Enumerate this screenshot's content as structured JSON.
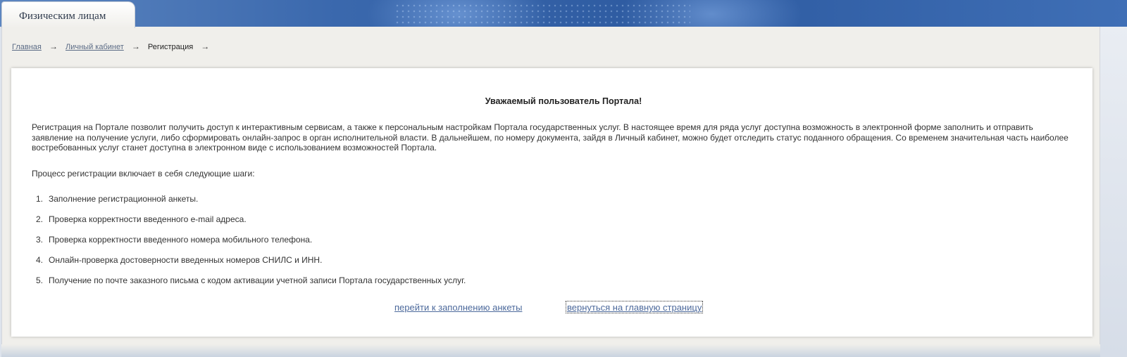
{
  "tabs": {
    "active": "Физическим лицам"
  },
  "breadcrumb": {
    "home": "Главная",
    "cabinet": "Личный кабинет",
    "current": "Регистрация",
    "separator": "→",
    "end_marker": "→"
  },
  "main": {
    "heading": "Уважаемый пользователь Портала!",
    "intro": "Регистрация на Портале позволит получить доступ к интерактивным сервисам, а также к персональным настройкам Портала государственных услуг. В настоящее время для ряда услуг доступна возможность в электронной форме заполнить и отправить заявление на получение услуги, либо сформировать онлайн-запрос в орган исполнительной власти. В дальнейшем, по номеру документа, зайдя в Личный кабинет, можно будет отследить статус поданного обращения. Со временем значительная часть наиболее востребованных услуг станет доступна в электронном виде с использованием возможностей Портала.",
    "steps_intro": "Процесс регистрации включает в себя следующие шаги:",
    "steps": [
      {
        "num": "1.",
        "text": "Заполнение регистрационной анкеты."
      },
      {
        "num": "2.",
        "text": "Проверка корректности введенного e-mail адреса."
      },
      {
        "num": "3.",
        "text": "Проверка корректности введенного номера мобильного телефона."
      },
      {
        "num": "4.",
        "text": "Онлайн-проверка достоверности введенных номеров СНИЛС и ИНН."
      },
      {
        "num": "5.",
        "text": "Получение по почте заказного письма с кодом активации учетной записи Портала государственных услуг."
      }
    ],
    "link_form": "перейти к заполнению анкеты",
    "link_home": "вернуться на главную страницу"
  },
  "colors": {
    "header_blue": "#3a68ad",
    "link": "#4d6a9c",
    "band": "#f0efeb"
  }
}
